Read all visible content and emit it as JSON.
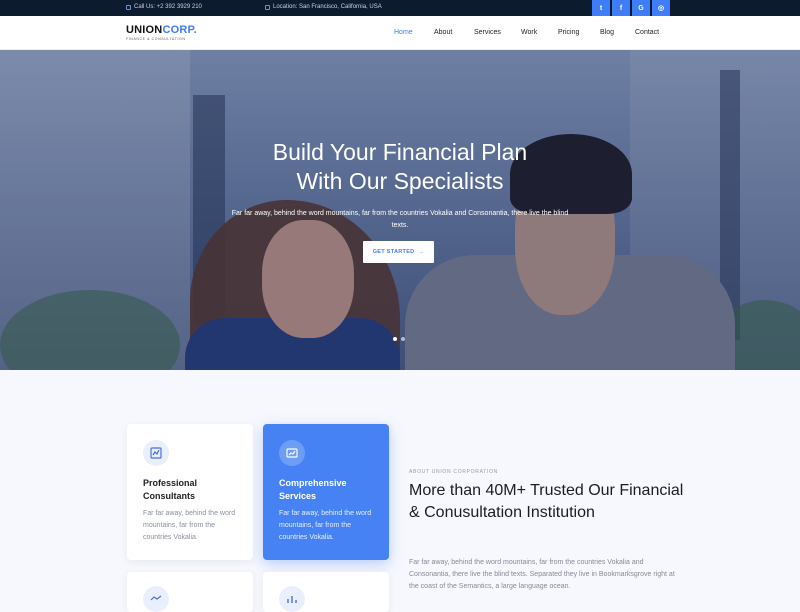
{
  "topbar": {
    "phone": "Call Us: +2 392 3929 210",
    "location": "Location: San Francisco, California, USA",
    "socials": [
      {
        "icon": "twitter-icon",
        "glyph": "t"
      },
      {
        "icon": "facebook-icon",
        "glyph": "f"
      },
      {
        "icon": "google-icon",
        "glyph": "G"
      },
      {
        "icon": "instagram-icon",
        "glyph": "◎"
      }
    ]
  },
  "brand": {
    "name_a": "UNION",
    "name_b": "CORP.",
    "tagline": "FINANCE & CONSULTATION"
  },
  "nav": {
    "items": [
      "Home",
      "About",
      "Services",
      "Work",
      "Pricing",
      "Blog",
      "Contact"
    ],
    "active": "Home"
  },
  "hero": {
    "title_line1": "Build Your Financial Plan",
    "title_line2": "With Our Specialists",
    "subtitle": "Far far away, behind the word mountains, far from the countries Vokalia and Consonantia, there live the blind texts.",
    "cta_label": "GET STARTED",
    "cta_arrow": "→",
    "slides": 2,
    "active_slide": 1
  },
  "services": {
    "cards": [
      {
        "title": "Professional Consultants",
        "text": "Far far away, behind the word mountains, far from the countries Vokalia.",
        "icon": "consultant-icon"
      },
      {
        "title": "Comprehensive Services",
        "text": "Far far away, behind the word mountains, far from the countries Vokalia.",
        "icon": "services-icon"
      }
    ]
  },
  "about": {
    "eyebrow": "ABOUT UNION CORPORATION",
    "title": "More than 40M+ Trusted Our Financial & Conusultation Institution",
    "text": "Far far away, behind the word mountains, far from the countries Vokalia and Consonantia, there live the blind texts. Separated they live in Bookmarksgrove right at the coast of the Semantics, a large language ocean."
  },
  "colors": {
    "accent": "#3f7cf7",
    "topbar": "#0d1b2e"
  }
}
